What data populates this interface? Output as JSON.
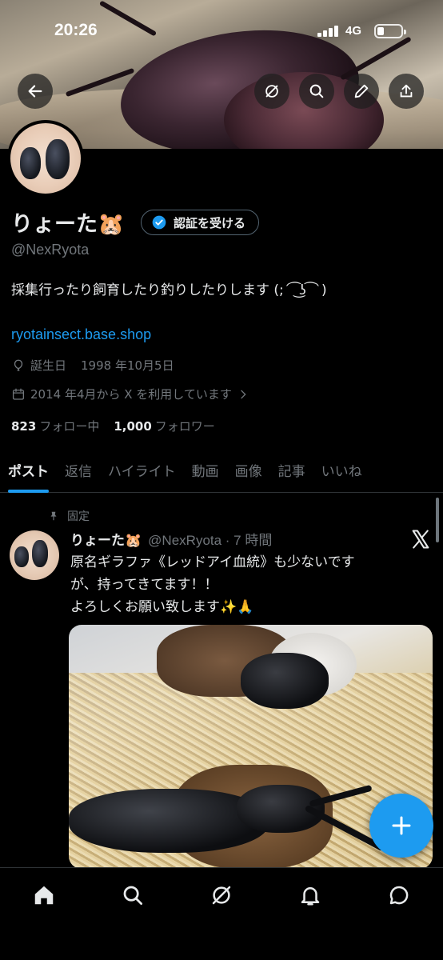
{
  "status_bar": {
    "time": "20:26",
    "network": "4G"
  },
  "profile": {
    "name": "りょーた🐹",
    "verify_button": "認証を受ける",
    "handle": "@NexRyota",
    "bio": "採集行ったり飼育したり釣りしたりします (;´ ͡ ͜ʖ ͡ `)",
    "link": "ryotainsect.base.shop",
    "birthday_label": "誕生日",
    "birthday": "1998 年10月5日",
    "joined": "2014 年4月から X を利用しています",
    "following_count": "823",
    "following_label": "フォロー中",
    "followers_count": "1,000",
    "followers_label": "フォロワー"
  },
  "tabs": [
    {
      "label": "ポスト",
      "active": true
    },
    {
      "label": "返信"
    },
    {
      "label": "ハイライト"
    },
    {
      "label": "動画"
    },
    {
      "label": "画像"
    },
    {
      "label": "記事"
    },
    {
      "label": "いいね"
    }
  ],
  "tweet": {
    "pinned_label": "固定",
    "name": "りょーた🐹",
    "handle_time": "@NexRyota · 7 時間",
    "lines": [
      "原名ギラファ《レッドアイ血統》も少ないです",
      "が、持ってきてます！！",
      "よろしくお願い致します✨🙏"
    ]
  },
  "icons": {
    "back": "arrow-left-icon",
    "grok": "grok-icon",
    "search": "search-icon",
    "edit": "pencil-icon",
    "share": "share-icon"
  },
  "colors": {
    "accent": "#1d9bf0",
    "muted": "#71767b",
    "text": "#e7e9ea",
    "background": "#000000"
  }
}
